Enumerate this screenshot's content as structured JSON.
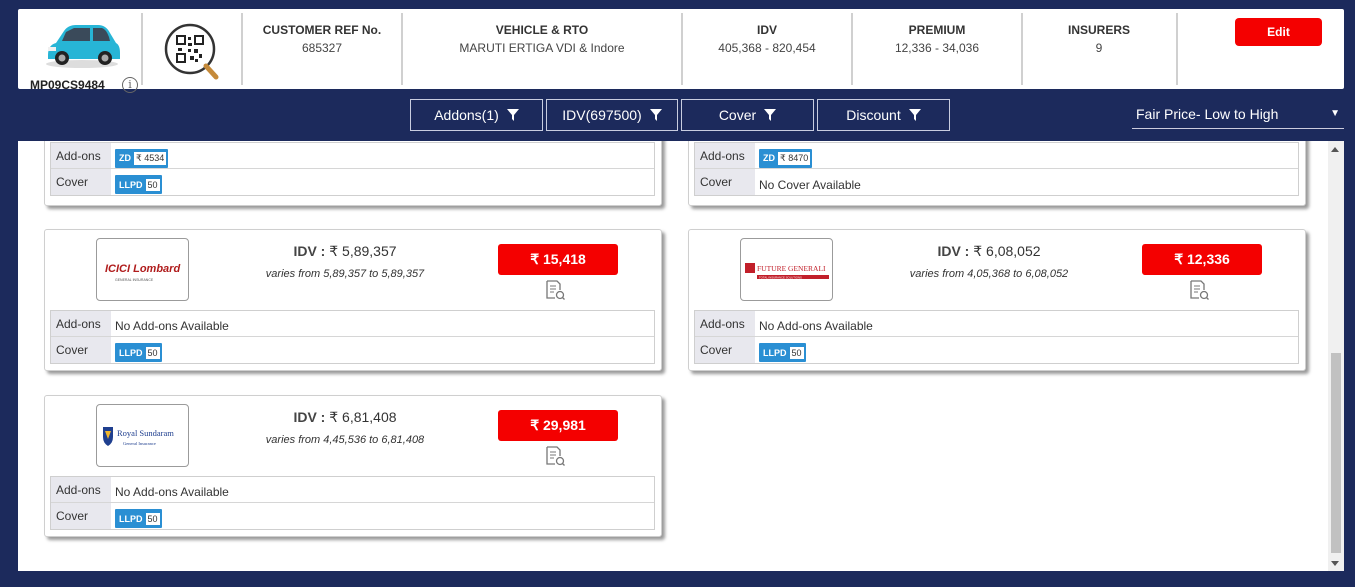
{
  "header": {
    "plate": "MP09CS9484",
    "columns": [
      {
        "title": "CUSTOMER REF No.",
        "value": "685327"
      },
      {
        "title": "VEHICLE & RTO",
        "value": "MARUTI ERTIGA VDI & Indore"
      },
      {
        "title": "IDV",
        "value": "405,368 - 820,454"
      },
      {
        "title": "PREMIUM",
        "value": "12,336 - 34,036"
      },
      {
        "title": "INSURERS",
        "value": "9"
      }
    ],
    "edit_label": "Edit"
  },
  "filters": [
    {
      "label": "Addons(1)"
    },
    {
      "label": "IDV(697500)"
    },
    {
      "label": "Cover"
    },
    {
      "label": "Discount"
    }
  ],
  "sort": {
    "selected": "Fair Price- Low to High"
  },
  "labels": {
    "addons": "Add-ons",
    "cover": "Cover"
  },
  "top_cards": [
    {
      "addon_code": "ZD",
      "addon_value": "₹ 4534",
      "cover_code": "LLPD",
      "cover_value": "50",
      "cover_text": ""
    },
    {
      "addon_code": "ZD",
      "addon_value": "₹ 8470",
      "cover_text": "No Cover Available"
    }
  ],
  "quotes": [
    {
      "insurer": "ICICI Lombard",
      "logo_text": "ICICI Lombard",
      "logo_sub": "GENERAL INSURANCE",
      "idv_label": "IDV :",
      "idv": "₹ 5,89,357",
      "varies": "varies from 5,89,357 to 5,89,357",
      "price": "₹ 15,418",
      "addons_text": "No Add-ons Available",
      "cover_code": "LLPD",
      "cover_value": "50"
    },
    {
      "insurer": "Future Generali",
      "logo_text": "FUTURE GENERALI",
      "logo_sub": "TOTAL INSURANCE SOLUTIONS",
      "idv_label": "IDV :",
      "idv": "₹ 6,08,052",
      "varies": "varies from 4,05,368 to 6,08,052",
      "price": "₹ 12,336",
      "addons_text": "No Add-ons Available",
      "cover_code": "LLPD",
      "cover_value": "50"
    },
    {
      "insurer": "Royal Sundaram",
      "logo_text": "Royal Sundaram",
      "logo_sub": "General Insurance",
      "idv_label": "IDV :",
      "idv": "₹ 6,81,408",
      "varies": "varies from 4,45,536 to 6,81,408",
      "price": "₹ 29,981",
      "addons_text": "No Add-ons Available",
      "cover_code": "LLPD",
      "cover_value": "50"
    }
  ],
  "colors": {
    "navy": "#1c2a5c",
    "red": "#f40000",
    "badge": "#2a8fd3"
  }
}
